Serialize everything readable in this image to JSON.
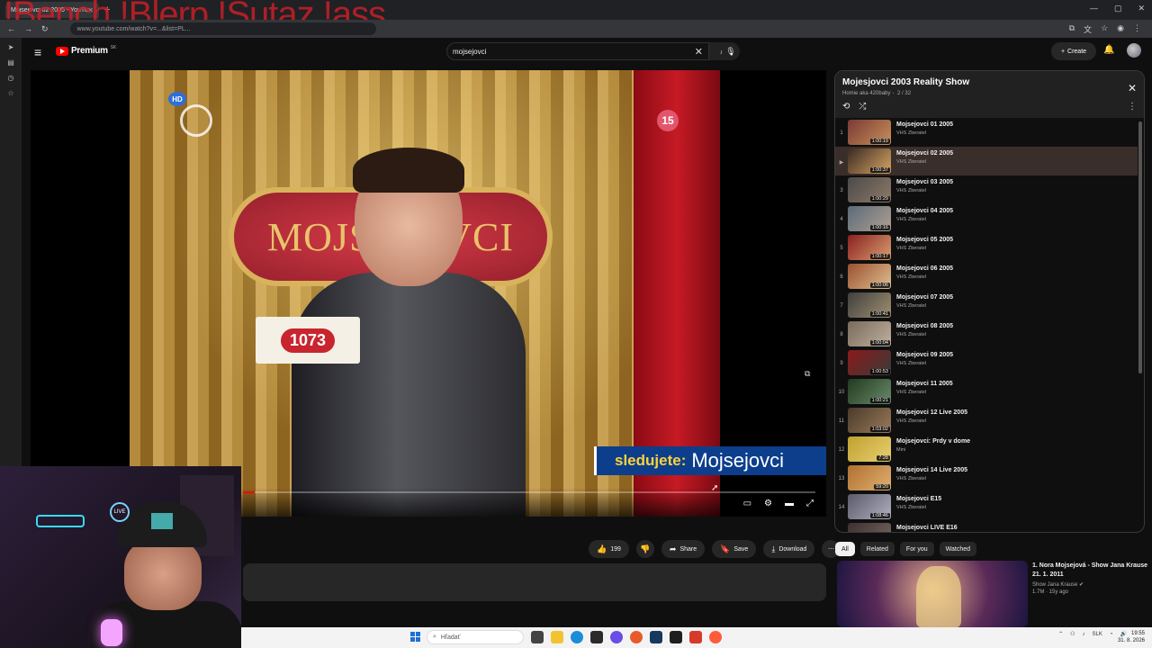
{
  "browser": {
    "tab_title": "Mojsejovci 02 2005 - YouTube",
    "url": "www.youtube.com/watch?v=...&list=PL...",
    "overlay_text": "!Bench !Blerp !Sutaz !ass"
  },
  "youtube": {
    "brand": "Premium",
    "region": "SK",
    "search_value": "mojsejovci",
    "create_label": "Create"
  },
  "video": {
    "stage_text": "MOJSEJOVCI",
    "badge_number": "1073",
    "hd_label": "HD",
    "rating": "15",
    "banner_prefix": "sledujete:",
    "banner_title": "Mojsejovci",
    "progress": 0.02
  },
  "actions": {
    "likes": "199",
    "share": "Share",
    "save": "Save",
    "download": "Download"
  },
  "playlist": {
    "title": "Mojesjovci 2003 Reality Show",
    "owner": "Homie aka 420baby",
    "position": "2 / 32",
    "items": [
      {
        "idx": "1",
        "title": "Mojsejovci 01 2005",
        "channel": "VHS Zberatel",
        "duration": "1:00:19",
        "active": false
      },
      {
        "idx": "▶",
        "title": "Mojsejovci 02 2005",
        "channel": "VHS Zberatel",
        "duration": "1:00:37",
        "active": true
      },
      {
        "idx": "3",
        "title": "Mojsejovci 03 2005",
        "channel": "VHS Zberatel",
        "duration": "1:00:29",
        "active": false
      },
      {
        "idx": "4",
        "title": "Mojsejovci 04 2005",
        "channel": "VHS Zberatel",
        "duration": "1:00:16",
        "active": false
      },
      {
        "idx": "5",
        "title": "Mojsejovci 05 2005",
        "channel": "VHS Zberatel",
        "duration": "1:00:17",
        "active": false
      },
      {
        "idx": "6",
        "title": "Mojsejovci 06 2005",
        "channel": "VHS Zberatel",
        "duration": "1:00:06",
        "active": false
      },
      {
        "idx": "7",
        "title": "Mojsejovci 07 2005",
        "channel": "VHS Zberatel",
        "duration": "1:00:41",
        "active": false
      },
      {
        "idx": "8",
        "title": "Mojsejovci 08 2005",
        "channel": "VHS Zberatel",
        "duration": "1:00:04",
        "active": false
      },
      {
        "idx": "9",
        "title": "Mojsejovci 09 2005",
        "channel": "VHS Zberatel",
        "duration": "1:00:53",
        "active": false
      },
      {
        "idx": "10",
        "title": "Mojsejovci 11 2005",
        "channel": "VHS Zberatel",
        "duration": "1:00:21",
        "active": false
      },
      {
        "idx": "11",
        "title": "Mojsejovci 12 Live 2005",
        "channel": "VHS Zberatel",
        "duration": "1:03:02",
        "active": false
      },
      {
        "idx": "12",
        "title": "Mojsejovci: Prdy v dome",
        "channel": "Mini",
        "duration": "7:28",
        "active": false
      },
      {
        "idx": "13",
        "title": "Mojsejovci 14 Live 2005",
        "channel": "VHS Zberatel",
        "duration": "59:20",
        "active": false
      },
      {
        "idx": "14",
        "title": "Mojsejovci E15",
        "channel": "VHS Zberatel",
        "duration": "1:08:46",
        "active": false
      },
      {
        "idx": "15",
        "title": "Mojsejovci LIVE E16",
        "channel": "",
        "duration": "",
        "active": false
      }
    ]
  },
  "chips": [
    "All",
    "Related",
    "For you",
    "Watched"
  ],
  "related": {
    "title": "1. Nora Mojsejová - Show Jana Krause 21. 1. 2011",
    "channel": "Show Jana Krause",
    "stats": "1.7M · 15y ago"
  },
  "taskbar": {
    "search_placeholder": "Hľadať",
    "lang": "SLK",
    "time": "19:55",
    "date": "31. 8. 2026"
  },
  "webcam": {
    "live_label": "LIVE"
  }
}
